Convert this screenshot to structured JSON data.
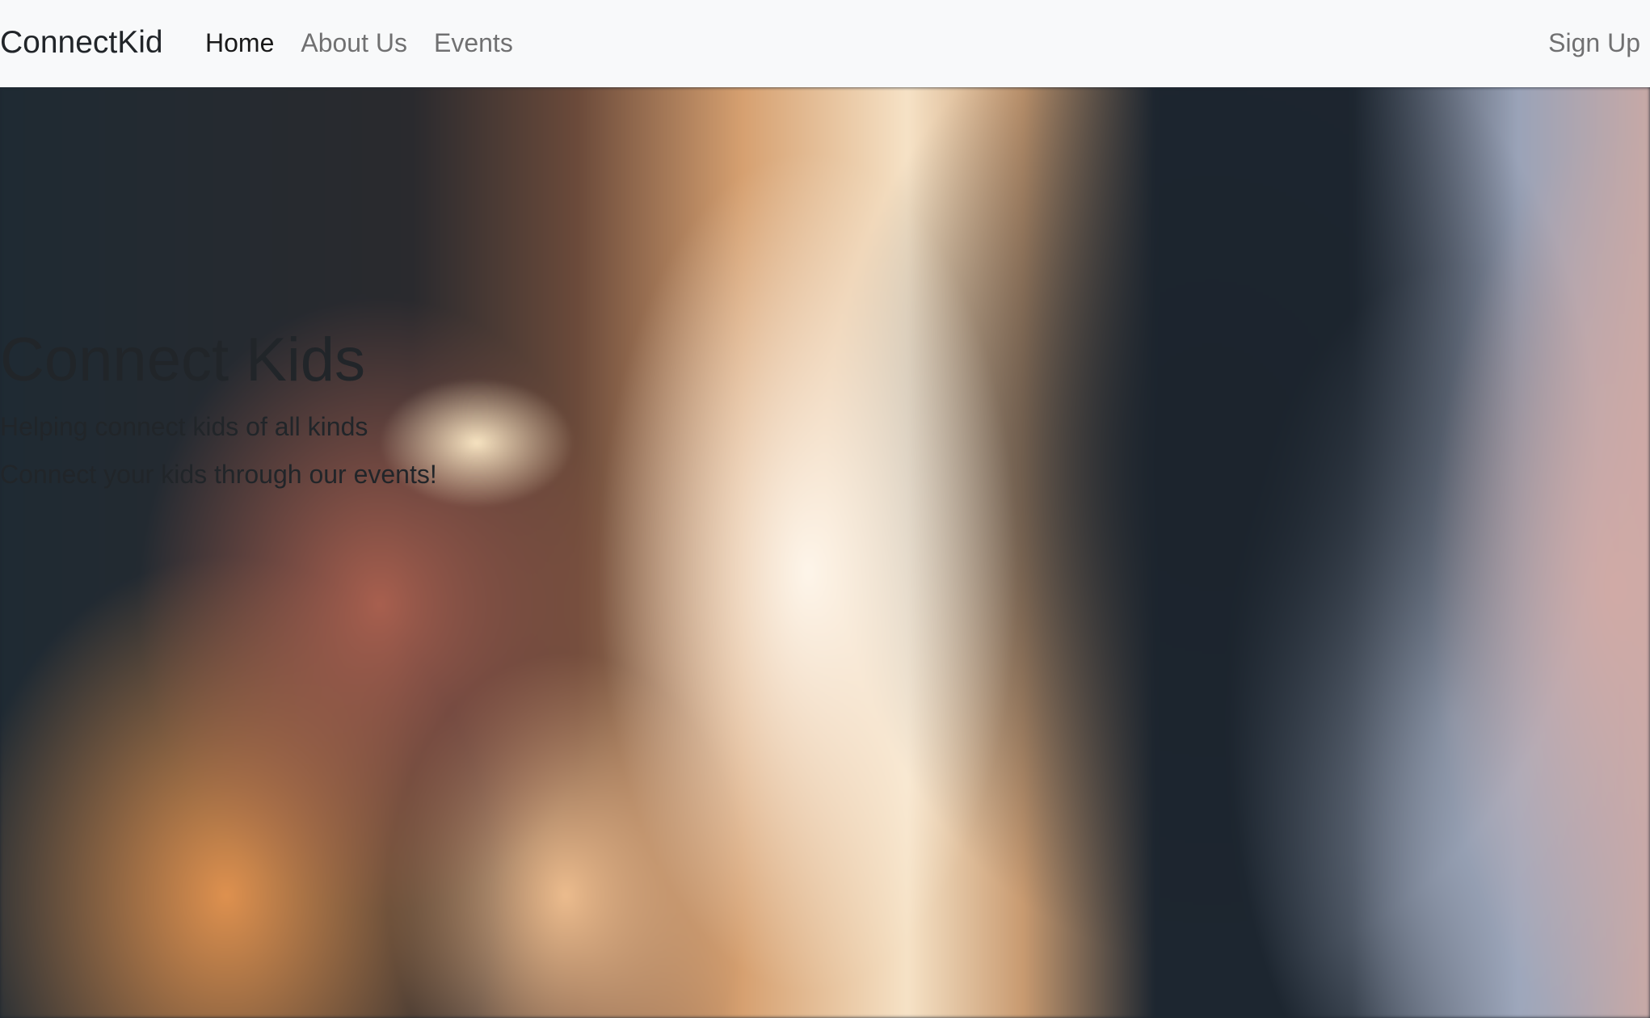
{
  "navbar": {
    "brand": "ConnectKid",
    "links": [
      {
        "label": "Home",
        "active": true
      },
      {
        "label": "About Us",
        "active": false
      },
      {
        "label": "Events",
        "active": false
      }
    ],
    "signup_label": "Sign Up"
  },
  "hero": {
    "title": "Connect Kids",
    "subtitle": "Helping connect kids of all kinds",
    "tagline": "Connect your kids through our events!"
  },
  "colors": {
    "navbar_bg": "#f8f9fa",
    "text_dark": "#212529"
  }
}
